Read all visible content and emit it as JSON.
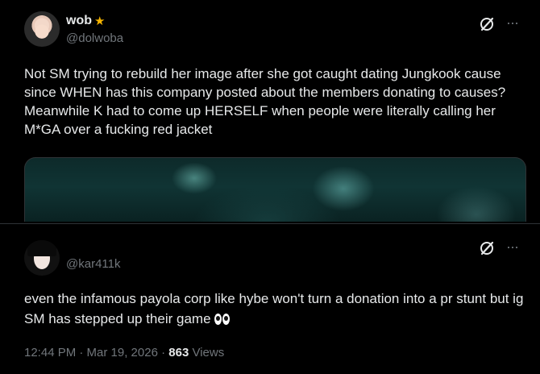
{
  "quoted_tweet": {
    "display_name": "wob",
    "badge_icon": "star-icon",
    "handle": "@dolwoba",
    "text": "Not SM trying to rebuild her image after she got caught dating Jungkook cause since WHEN has this company posted about the members donating to causes? Meanwhile K had to come up HERSELF when people were literally calling her M*GA over a fucking red jacket",
    "media": "image"
  },
  "reply_tweet": {
    "handle": "@kar411k",
    "text": "even the infamous payola corp like hybe won't turn a donation into a pr stunt but ig SM has stepped up their game",
    "emoji": "eyes-emoji",
    "timestamp": "12:44 PM · Mar 19, 2026 · ",
    "views_count": "863",
    "views_label": " Views"
  },
  "colors": {
    "background": "#000000",
    "text_primary": "#e7e9ea",
    "text_secondary": "#71767b",
    "star": "#f5b400",
    "border": "#2f3336"
  }
}
